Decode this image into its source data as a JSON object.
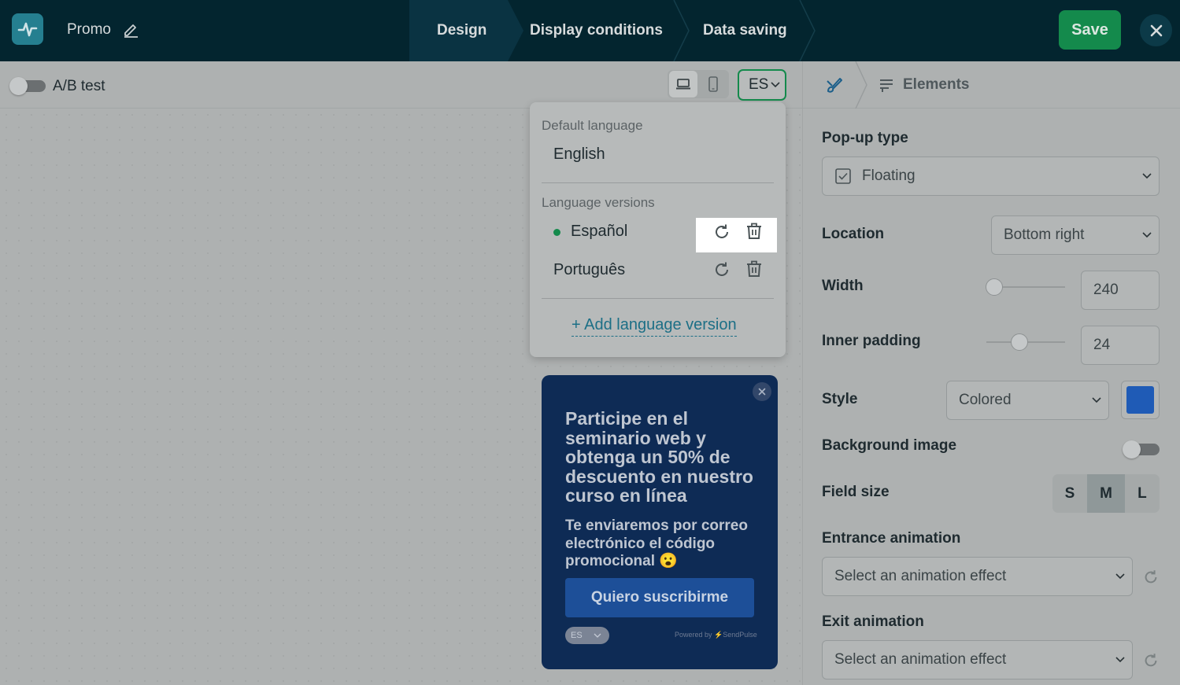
{
  "header": {
    "title": "Promo",
    "steps": [
      "Design",
      "Display conditions",
      "Data saving"
    ],
    "save_label": "Save"
  },
  "toolbar": {
    "ab_test_label": "A/B test",
    "language_code": "ES"
  },
  "language_dropdown": {
    "default_caption": "Default language",
    "default_language": "English",
    "versions_caption": "Language versions",
    "versions": [
      "Español",
      "Português"
    ],
    "add_label": "+ Add language version"
  },
  "popup_preview": {
    "heading": "Participe en el seminario web y obtenga un 50% de descuento en nuestro curso en línea",
    "text": "Te enviaremos por correo electrónico el código promocional 😮",
    "button_label": "Quiero suscribirme",
    "language_code": "ES",
    "powered_prefix": "Powered by",
    "powered_brand": "SendPulse"
  },
  "panel": {
    "elements_label": "Elements",
    "popup_type_label": "Pop-up type",
    "popup_type_value": "Floating",
    "location_label": "Location",
    "location_value": "Bottom right",
    "width_label": "Width",
    "width_value": "240",
    "padding_label": "Inner padding",
    "padding_value": "24",
    "style_label": "Style",
    "style_value": "Colored",
    "style_color": "#1f5bb6",
    "bg_image_label": "Background image",
    "field_size_label": "Field size",
    "field_sizes": [
      "S",
      "M",
      "L"
    ],
    "field_size_selected": "M",
    "entrance_label": "Entrance animation",
    "entrance_placeholder": "Select an animation effect",
    "exit_label": "Exit animation",
    "exit_placeholder": "Select an animation effect"
  },
  "colors": {
    "accent_green": "#148a4c",
    "topbar": "#03252f",
    "popup_background": "#0e2b55",
    "popup_button": "#1d4f98",
    "link": "#1c6f86"
  }
}
